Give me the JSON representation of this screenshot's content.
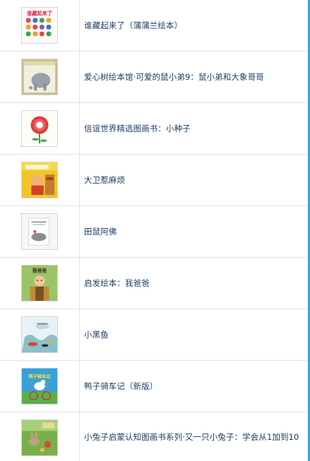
{
  "books": [
    {
      "title": "谁藏起来了（蒲蒲兰绘本）",
      "cover_text": "谁藏起来了",
      "cover": "hide-cover"
    },
    {
      "title": "爱心树绘本馆·可爱的鼠小弟9：鼠小弟和大象哥哥",
      "cover_text": "",
      "cover": "mouse-elephant-cover"
    },
    {
      "title": "信谊世界精选图画书：小种子",
      "cover_text": "",
      "cover": "seed-cover"
    },
    {
      "title": "大卫惹麻烦",
      "cover_text": "",
      "cover": "david-cover"
    },
    {
      "title": "田鼠阿佛",
      "cover_text": "",
      "cover": "frederick-cover"
    },
    {
      "title": "启发绘本：我爸爸",
      "cover_text": "我爸爸",
      "cover": "dad-cover"
    },
    {
      "title": "小黑鱼",
      "cover_text": "",
      "cover": "swimmy-cover"
    },
    {
      "title": "鸭子骑车记（新版）",
      "cover_text": "鸭子骑车记",
      "cover": "duck-bike-cover"
    },
    {
      "title": "小兔子启蒙认知图画书系列·又一只小兔子：学会从1加到10",
      "cover_text": "",
      "cover": "rabbit-cover"
    }
  ],
  "colors": {
    "title_text": "#1f3d66",
    "row_divider": "#e3e3e3",
    "scroll_edge": "#33a8d6"
  }
}
